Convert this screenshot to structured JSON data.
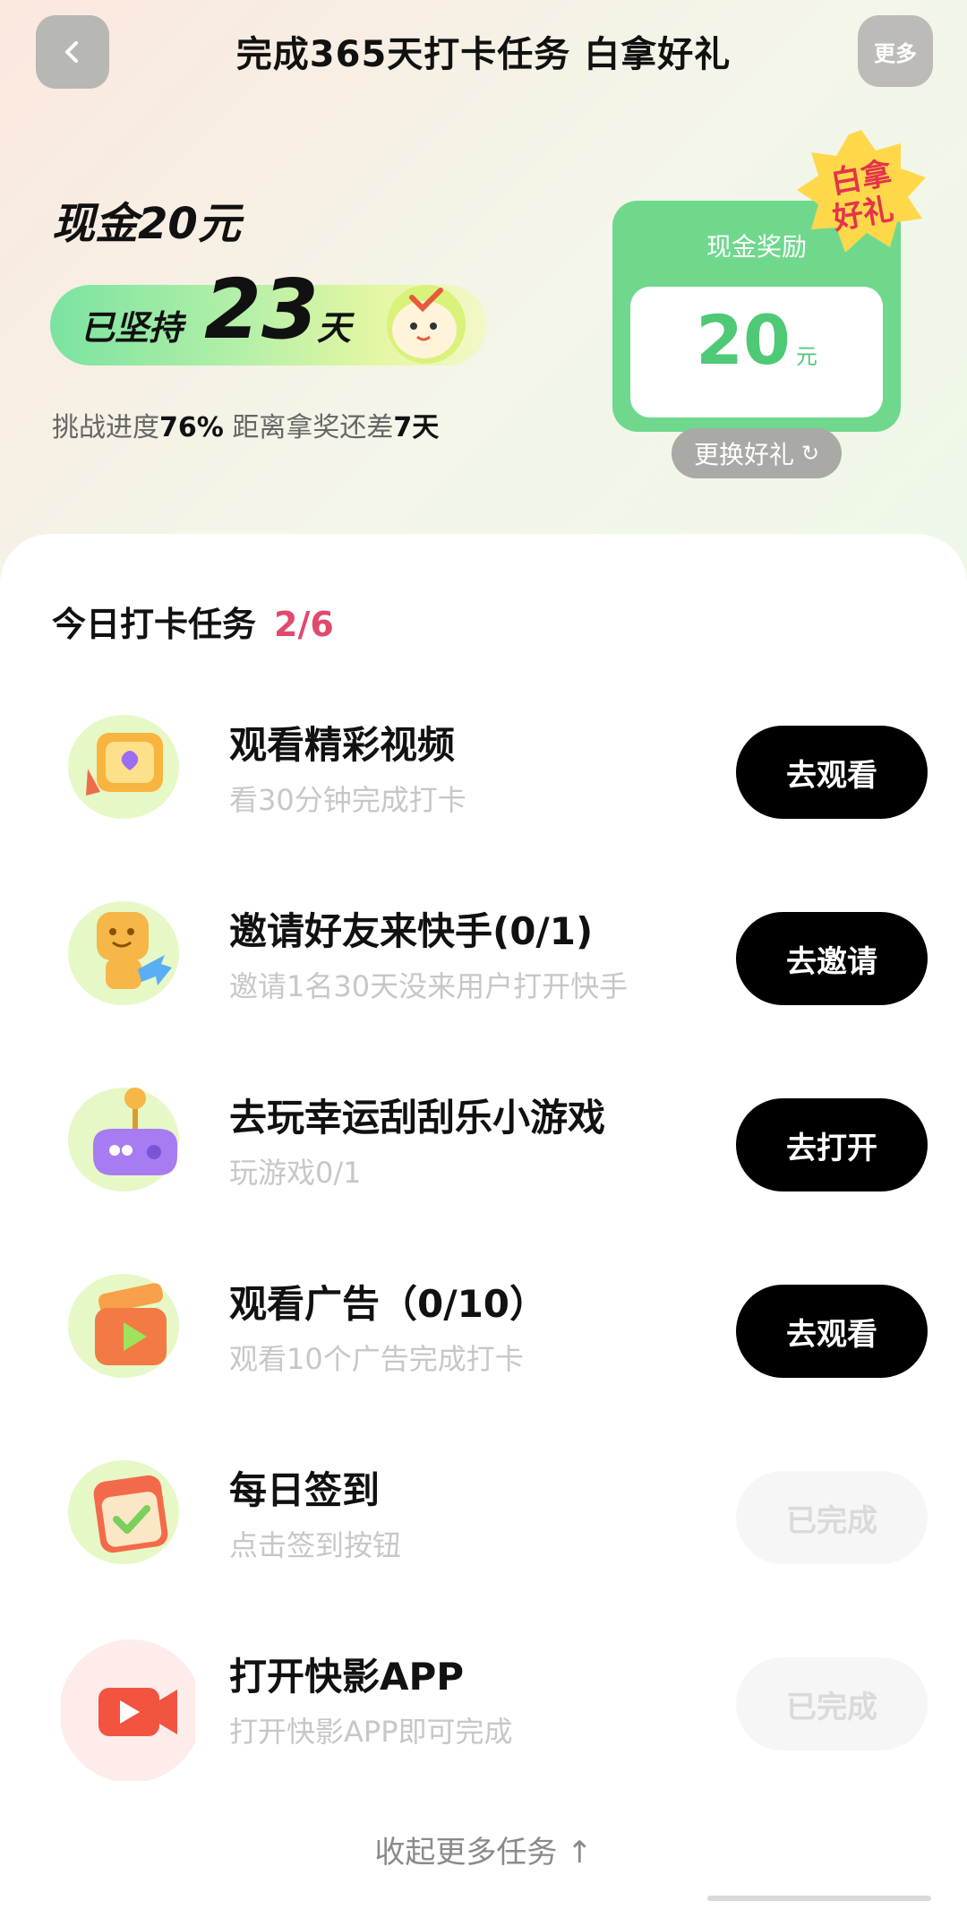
{
  "header": {
    "title": "完成365天打卡任务 白拿好礼",
    "more_label": "更多"
  },
  "hero": {
    "cash_title": "现金20元",
    "days_prefix": "已坚持",
    "days_count": "23",
    "days_suffix": "天",
    "progress_label": "挑战进度",
    "progress_value": "76%",
    "remaining_label": " 距离拿奖还差",
    "remaining_value": "7天"
  },
  "reward": {
    "label": "现金奖励",
    "value": "20",
    "unit": "元",
    "badge_line1": "白拿",
    "badge_line2": "好礼",
    "change_label": "更换好礼",
    "change_icon": "refresh-icon"
  },
  "tasks_panel": {
    "title": "今日打卡任务",
    "count": "2/6",
    "collapse_label": "收起更多任务 ↑",
    "items": [
      {
        "icon": "video-tv-icon",
        "title": "观看精彩视频",
        "subtitle": "看30分钟完成打卡",
        "button": "去观看",
        "done": false
      },
      {
        "icon": "invite-friend-icon",
        "title": "邀请好友来快手(0/1)",
        "subtitle": "邀请1名30天没来用户打开快手",
        "button": "去邀请",
        "done": false
      },
      {
        "icon": "joystick-icon",
        "title": "去玩幸运刮刮乐小游戏",
        "subtitle": "玩游戏0/1",
        "button": "去打开",
        "done": false
      },
      {
        "icon": "ad-play-icon",
        "title": "观看广告（0/10）",
        "subtitle": "观看10个广告完成打卡",
        "button": "去观看",
        "done": false
      },
      {
        "icon": "calendar-check-icon",
        "title": "每日签到",
        "subtitle": "点击签到按钮",
        "button": "已完成",
        "done": true
      },
      {
        "icon": "video-camera-icon",
        "title": "打开快影APP",
        "subtitle": "打开快影APP即可完成",
        "button": "已完成",
        "done": true
      }
    ]
  },
  "colors": {
    "accent_green": "#6fd88d",
    "count_red": "#e04a6d",
    "button_black": "#000000"
  }
}
